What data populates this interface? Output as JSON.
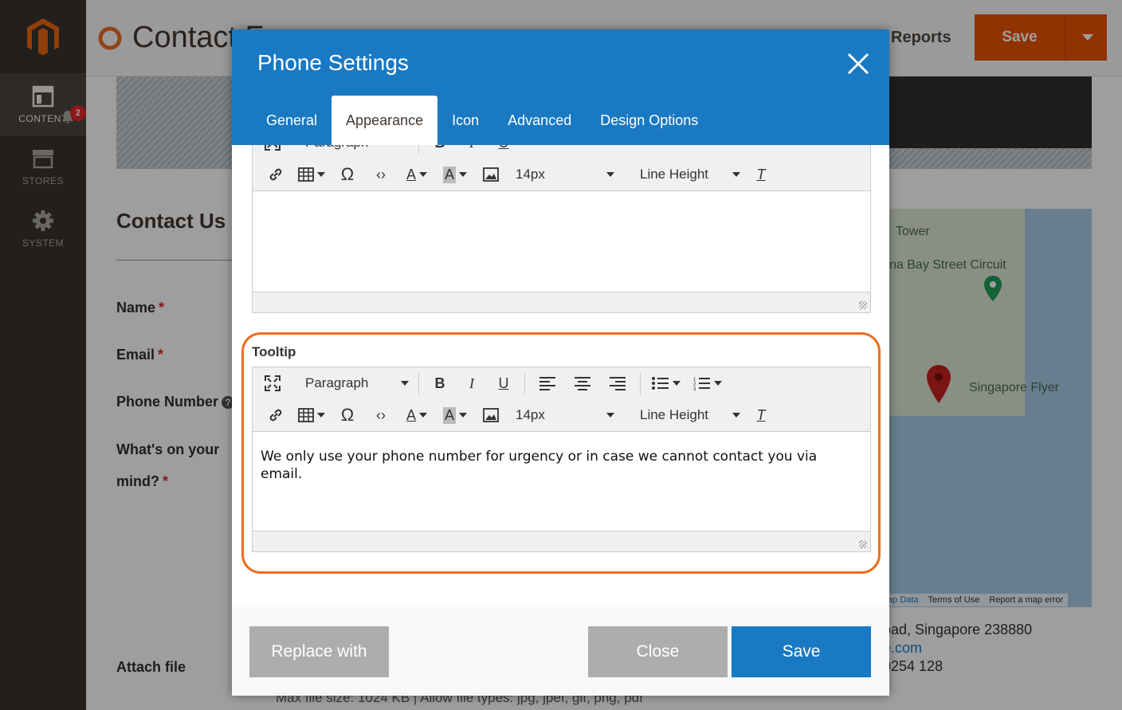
{
  "sidebar": {
    "logo": "magento-logo",
    "items": [
      {
        "label": "CONTENT",
        "icon": "content-icon",
        "active": true
      },
      {
        "label": "STORES",
        "icon": "store-icon",
        "active": false
      },
      {
        "label": "SYSTEM",
        "icon": "gear-icon",
        "active": false
      }
    ],
    "notification_count": "2"
  },
  "page": {
    "title": "Contact F",
    "reports_label": "Reports",
    "save_label": "Save",
    "contact_heading": "Contact Us",
    "fields": {
      "name": "Name",
      "email": "Email",
      "phone": "Phone Number",
      "mind_line1": "What's on your",
      "mind_line2": "mind?",
      "attach": "Attach file"
    },
    "required_mark": "*",
    "help_mark": "?",
    "map": {
      "label_tower": "Tower",
      "label_circuit": "na Bay Street Circuit",
      "label_flyer": "Singapore Flyer",
      "footer_map_data": "ap Data",
      "footer_terms": "Terms of Use",
      "footer_report": "Report a map error"
    },
    "address_line": "oad, Singapore 238880",
    "email_fragment": "e.com",
    "phone_fragment": "0254 128",
    "max_file_text": "Max file size: 1024 KB | Allow file types: jpg, jpef, gif, png, pdf"
  },
  "modal": {
    "title": "Phone Settings",
    "tabs": [
      {
        "label": "General",
        "active": false
      },
      {
        "label": "Appearance",
        "active": true
      },
      {
        "label": "Icon",
        "active": false
      },
      {
        "label": "Advanced",
        "active": false
      },
      {
        "label": "Design Options",
        "active": false
      }
    ],
    "editor": {
      "format_select": "Paragraph",
      "font_size_select": "14px",
      "line_height_select": "Line Height"
    },
    "tooltip_label": "Tooltip",
    "tooltip_content": "We only use your phone number for urgency or in case we cannot contact you via email.",
    "buttons": {
      "replace": "Replace with",
      "close": "Close",
      "save": "Save"
    }
  },
  "colors": {
    "accent": "#1979c3",
    "header_save": "#eb5202",
    "highlight": "#ee6d1f",
    "sidebar": "#373330"
  }
}
